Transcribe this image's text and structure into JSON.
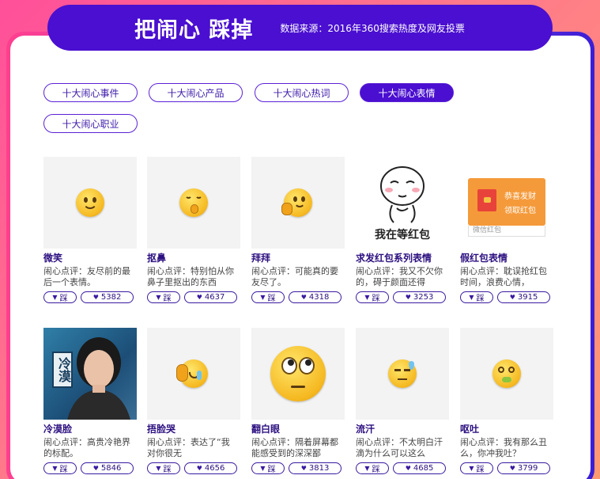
{
  "header": {
    "title": "把闹心 踩掉",
    "source": "数据来源：2016年360搜索热度及网友投票"
  },
  "tabs": [
    {
      "label": "十大闹心事件",
      "active": false
    },
    {
      "label": "十大闹心产品",
      "active": false
    },
    {
      "label": "十大闹心热词",
      "active": false
    },
    {
      "label": "十大闹心表情",
      "active": true
    },
    {
      "label": "十大闹心职业",
      "active": false
    }
  ],
  "down_label": "踩",
  "cards": [
    {
      "name": "微笑",
      "desc": "闹心点评：友尽前的最后一个表情。",
      "count": "5382",
      "icon": "smile-emoji-icon"
    },
    {
      "name": "抠鼻",
      "desc": "闹心点评：特别怕从你鼻子里抠出的东西",
      "count": "4637",
      "icon": "pick-nose-emoji-icon"
    },
    {
      "name": "拜拜",
      "desc": "闹心点评：可能真的要友尽了。",
      "count": "4318",
      "icon": "bye-emoji-icon"
    },
    {
      "name": "求发红包系列表情",
      "desc": "闹心点评：我又不欠你的，碍于颜面还得",
      "count": "3253",
      "icon": "waiting-red-packet-sticker",
      "sticker_text": "我在等红包"
    },
    {
      "name": "假红包表情",
      "desc": "闹心点评：耽误抢红包时间，浪费心情，",
      "count": "3915",
      "icon": "fake-red-packet-image",
      "packet_line1": "恭喜发财",
      "packet_line2": "领取红包",
      "packet_footer": "微信红包"
    },
    {
      "name": "冷漠脸",
      "desc": "闹心点评：高贵冷艳界的标配。",
      "count": "5846",
      "icon": "cold-face-photo",
      "badge": "冷漠"
    },
    {
      "name": "捂脸哭",
      "desc": "闹心点评：表达了“我对你很无",
      "count": "4656",
      "icon": "facepalm-emoji-icon"
    },
    {
      "name": "翻白眼",
      "desc": "闹心点评：隔着屏幕都能感受到的深深鄙",
      "count": "3813",
      "icon": "eye-roll-emoji-icon"
    },
    {
      "name": "流汗",
      "desc": "闹心点评：不太明白汗滴为什么可以这么",
      "count": "4685",
      "icon": "sweat-emoji-icon"
    },
    {
      "name": "呕吐",
      "desc": "闹心点评：我有那么丑么，你冲我吐？",
      "count": "3799",
      "icon": "vomit-emoji-icon"
    }
  ]
}
